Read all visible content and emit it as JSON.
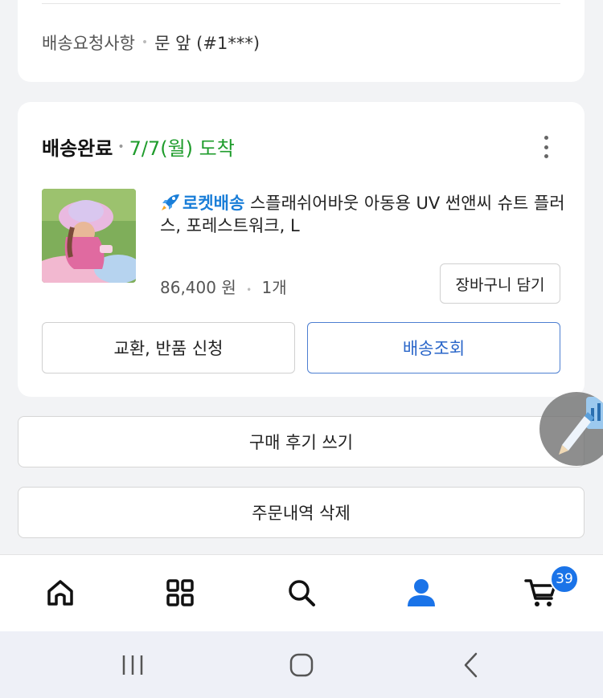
{
  "delivery_request": {
    "label": "배송요청사항",
    "value": "문 앞 (#1***)"
  },
  "order": {
    "status": "배송완료",
    "arrival": "7/7(월) 도착",
    "product": {
      "rocket_label": "로켓배송",
      "name": "스플래쉬어바웃 아동용 UV 썬앤씨 슈트 플러스, 포레스트워크, L",
      "price": "86,400 원",
      "quantity": "1개"
    },
    "add_to_cart_label": "장바구니 담기",
    "return_button_label": "교환, 반품 신청",
    "tracking_button_label": "배송조회"
  },
  "review_button_label": "구매 후기 쓰기",
  "delete_button_label": "주문내역 삭제",
  "bottom_nav": {
    "items": [
      "home-icon",
      "category-icon",
      "search-icon",
      "my-coupang-icon",
      "cart-icon"
    ],
    "cart_badge": "39",
    "active_color": "#1a73e8"
  },
  "colors": {
    "arrival_green": "#1f9c2c",
    "rocket_blue": "#1a7ed8",
    "tracking_blue": "#2a66c9"
  }
}
